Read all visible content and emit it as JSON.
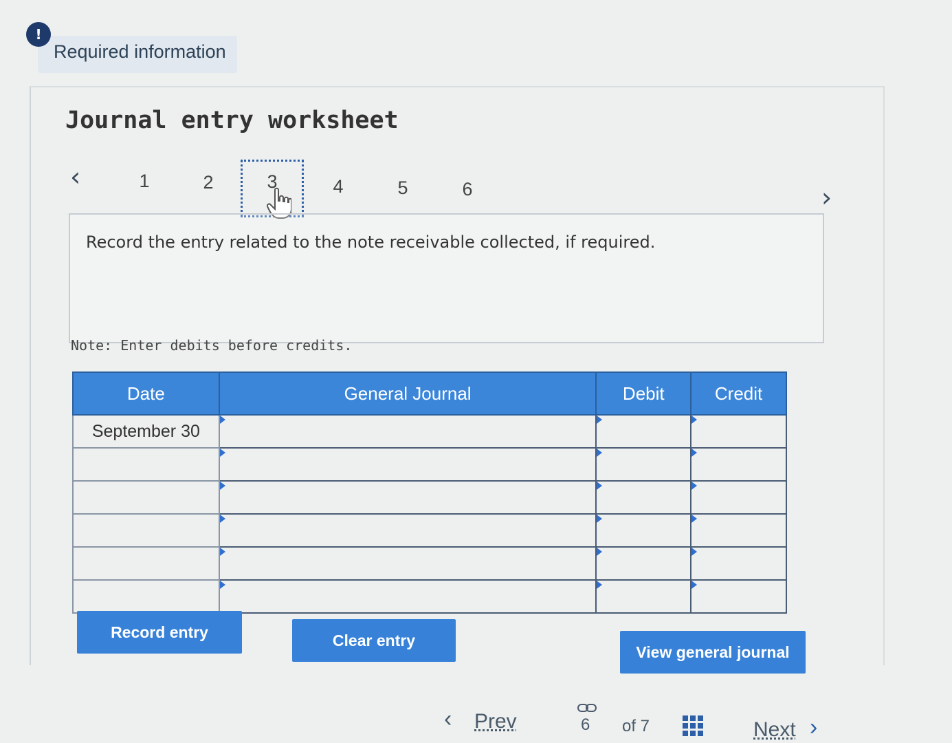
{
  "header": {
    "alert_symbol": "!",
    "required_label": "Required information"
  },
  "worksheet": {
    "title": "Journal entry worksheet",
    "steps": [
      "1",
      "2",
      "3",
      "4",
      "5",
      "6"
    ],
    "active_step": "3",
    "instruction": "Record the entry related to the note receivable collected, if required.",
    "note": "Note: Enter debits before credits."
  },
  "journal": {
    "columns": [
      "Date",
      "General Journal",
      "Debit",
      "Credit"
    ],
    "rows": [
      {
        "date": "September 30",
        "account": "",
        "debit": "",
        "credit": ""
      },
      {
        "date": "",
        "account": "",
        "debit": "",
        "credit": ""
      },
      {
        "date": "",
        "account": "",
        "debit": "",
        "credit": ""
      },
      {
        "date": "",
        "account": "",
        "debit": "",
        "credit": ""
      },
      {
        "date": "",
        "account": "",
        "debit": "",
        "credit": ""
      },
      {
        "date": "",
        "account": "",
        "debit": "",
        "credit": ""
      }
    ]
  },
  "buttons": {
    "record": "Record entry",
    "clear": "Clear entry",
    "view_journal": "View general journal"
  },
  "footer": {
    "prev_label": "Prev",
    "current_page": "6",
    "of_total": "of 7",
    "next_label": "Next"
  },
  "colors": {
    "header_blue": "#3b86d9",
    "button_blue": "#3782d8",
    "alert_navy": "#1d3a6b"
  }
}
